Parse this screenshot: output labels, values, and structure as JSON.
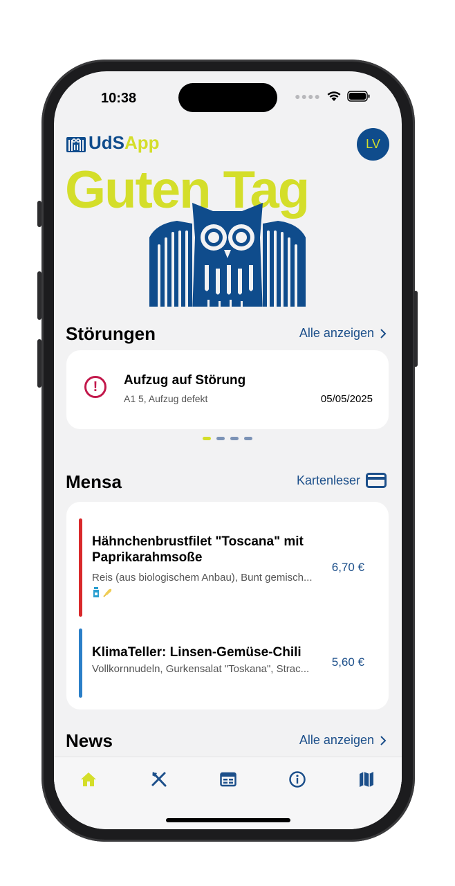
{
  "status": {
    "time": "10:38"
  },
  "header": {
    "logo_main": "UdS",
    "logo_accent": "App",
    "avatar_initials": "LV",
    "greeting": "Guten Tag"
  },
  "stoerungen": {
    "title": "Störungen",
    "link": "Alle anzeigen",
    "item": {
      "title": "Aufzug auf Störung",
      "subtitle": "A1 5, Aufzug defekt",
      "date": "05/05/2025"
    },
    "pager": {
      "count": 4,
      "active": 1
    }
  },
  "mensa": {
    "title": "Mensa",
    "link": "Kartenleser",
    "meals": [
      {
        "name": "Hähnchenbrustfilet \"Toscana\" mit Paprikarahmsoße",
        "desc": "Reis (aus biologischem Anbau), Bunt gemisch...",
        "price": "6,70 €",
        "color": "#d9292b"
      },
      {
        "name": "KlimaTeller: Linsen-Gemüse-Chili",
        "desc": "Vollkornnudeln, Gurkensalat \"Toskana\", Strac...",
        "price": "5,60 €",
        "color": "#2b7fc8"
      }
    ]
  },
  "news": {
    "title": "News",
    "link": "Alle anzeigen"
  },
  "tabbar": {
    "tabs": [
      "home-icon",
      "mensa-icon",
      "calendar-icon",
      "info-icon",
      "map-icon"
    ],
    "active": 0,
    "accent": "#d4de2a",
    "primary": "#1c4f8a"
  }
}
